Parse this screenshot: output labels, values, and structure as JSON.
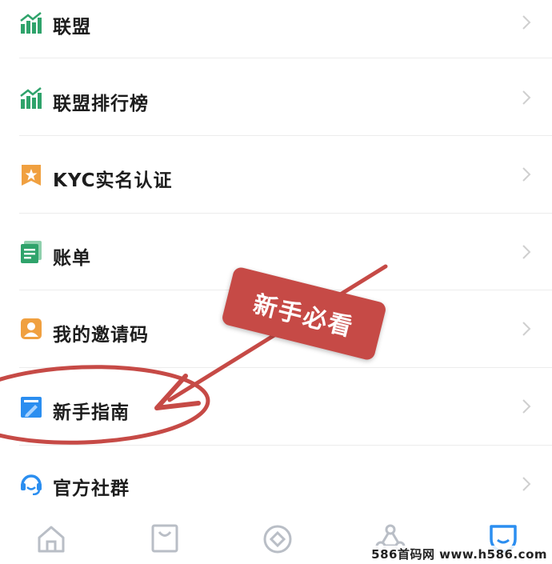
{
  "menu": {
    "items": [
      {
        "label": "联盟",
        "icon": "bar-chart-icon"
      },
      {
        "label": "联盟排行榜",
        "icon": "bar-chart-icon"
      },
      {
        "label": "KYC实名认证",
        "icon": "star-badge-icon"
      },
      {
        "label": "账单",
        "icon": "bill-icon"
      },
      {
        "label": "我的邀请码",
        "icon": "invite-code-icon"
      },
      {
        "label": "新手指南",
        "icon": "guide-book-icon"
      },
      {
        "label": "官方社群",
        "icon": "headset-icon"
      }
    ]
  },
  "annotation": {
    "stamp_text": "新手必看",
    "color": "#c64a46"
  },
  "tabbar": {
    "tabs": [
      {
        "icon": "home-icon"
      },
      {
        "icon": "bag-icon"
      },
      {
        "icon": "compass-icon"
      },
      {
        "icon": "network-icon"
      },
      {
        "icon": "profile-icon",
        "active": true
      }
    ]
  },
  "watermark": "586首码网 www.h586.com",
  "colors": {
    "green": "#2fa36b",
    "orange": "#f0a040",
    "blue": "#2b8ef0",
    "tab_gray": "#b9bec6",
    "tab_active": "#2b8ef0"
  }
}
